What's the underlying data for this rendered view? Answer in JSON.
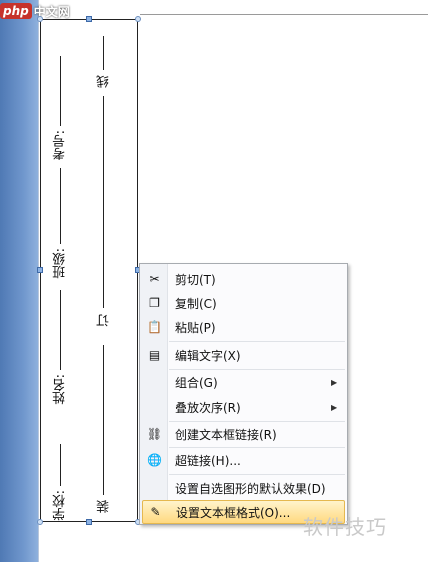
{
  "watermark": {
    "logo": "php",
    "text": "中文网"
  },
  "textbox": {
    "col_left": [
      "学校:",
      "姓名:",
      "班级:",
      "考号:"
    ],
    "col_right": [
      "装",
      "订",
      "线"
    ]
  },
  "menu": {
    "items": [
      {
        "label": "剪切(T)",
        "icon": "scissors-icon",
        "glyph": "✂"
      },
      {
        "label": "复制(C)",
        "icon": "copy-icon",
        "glyph": "❐"
      },
      {
        "label": "粘贴(P)",
        "icon": "paste-icon",
        "glyph": "📋"
      },
      {
        "label": "编辑文字(X)",
        "icon": "edit-text-icon",
        "glyph": "▤"
      },
      {
        "label": "组合(G)",
        "icon": "",
        "glyph": "",
        "submenu": true
      },
      {
        "label": "叠放次序(R)",
        "icon": "",
        "glyph": "",
        "submenu": true
      },
      {
        "label": "创建文本框链接(R)",
        "icon": "chain-link-icon",
        "glyph": "⛓"
      },
      {
        "label": "超链接(H)...",
        "icon": "globe-link-icon",
        "glyph": "🌐"
      },
      {
        "label": "设置自选图形的默认效果(D)",
        "icon": "",
        "glyph": ""
      },
      {
        "label": "设置文本框格式(O)...",
        "icon": "format-textbox-icon",
        "glyph": "✎",
        "highlighted": true
      }
    ],
    "arrow": "▶"
  },
  "corner_watermark": "软件技巧"
}
